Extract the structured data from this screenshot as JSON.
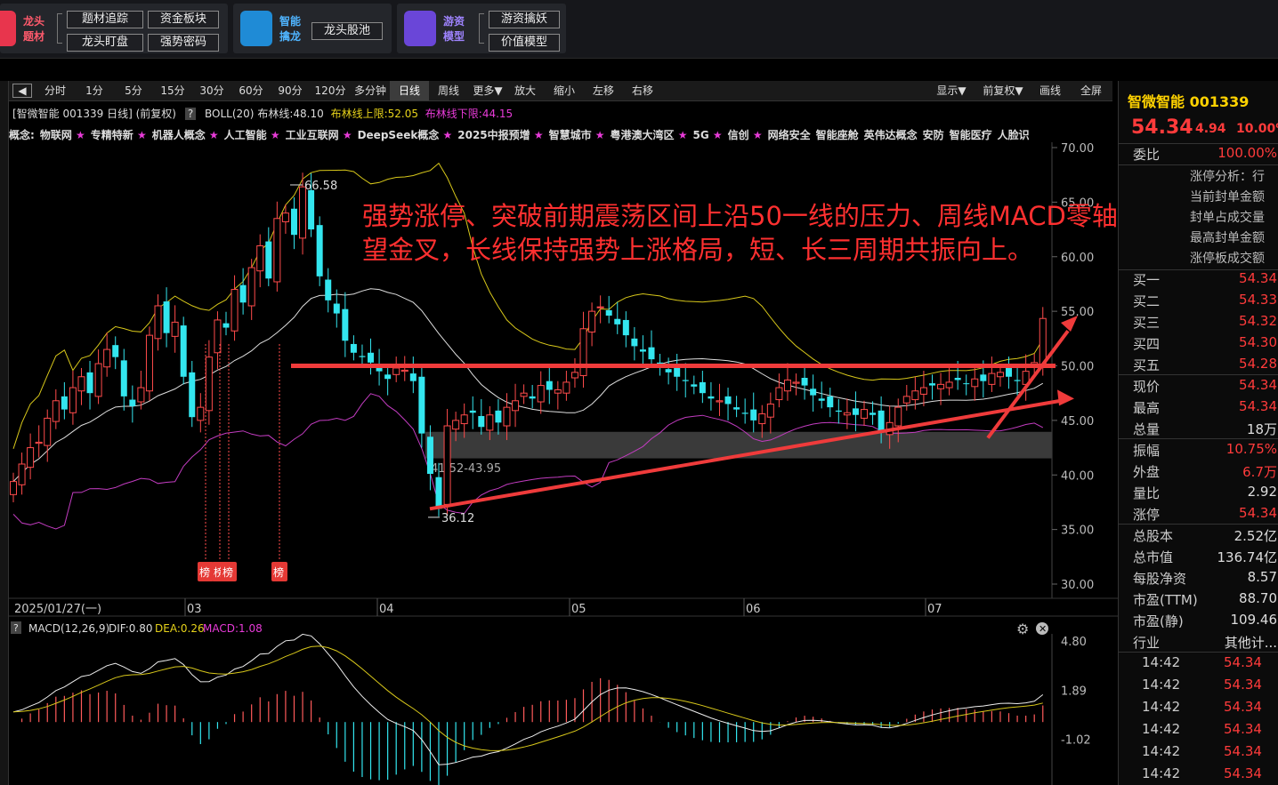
{
  "top_toolbar": {
    "group1": {
      "title": "龙头题材",
      "buttons": [
        "题材追踪",
        "资金板块",
        "龙头盯盘",
        "强势密码"
      ]
    },
    "group2": {
      "title": "智能擒龙",
      "buttons": [
        "龙头股池"
      ]
    },
    "group3": {
      "title": "游资模型",
      "buttons": [
        "游资擒妖",
        "价值模型"
      ]
    }
  },
  "chart_toolbar": {
    "periods": [
      "分时",
      "1分",
      "5分",
      "15分",
      "30分",
      "60分",
      "90分",
      "120分",
      "多分钟",
      "日线",
      "周线",
      "更多▼"
    ],
    "active_period": "日线",
    "tools": [
      "放大",
      "缩小",
      "左移",
      "右移"
    ],
    "right_tools": [
      "显示▼",
      "前复权▼",
      "画线",
      "全屏"
    ]
  },
  "info_line": {
    "stock": "[智微智能 001339 日线] (前复权)",
    "help": "?",
    "boll_label": "BOLL(20)",
    "mid": "布林线:48.10",
    "upper": "布林线上限:52.05",
    "lower": "布林线下限:44.15"
  },
  "concept_line": {
    "prefix": "概念:",
    "items": [
      {
        "name": "物联网",
        "star": true
      },
      {
        "name": "专精特新",
        "star": true
      },
      {
        "name": "机器人概念",
        "star": true
      },
      {
        "name": "人工智能",
        "star": true
      },
      {
        "name": "工业互联网",
        "star": true
      },
      {
        "name": "DeepSeek概念",
        "star": true
      },
      {
        "name": "2025中报预增",
        "star": true
      },
      {
        "name": "智慧城市",
        "star": true
      },
      {
        "name": "粤港澳大湾区",
        "star": true
      },
      {
        "name": "5G",
        "star": true
      },
      {
        "name": "信创",
        "star": true
      },
      {
        "name": "网络安全",
        "star": false
      },
      {
        "name": "智能座舱",
        "star": false
      },
      {
        "name": "英伟达概念",
        "star": false
      },
      {
        "name": "安防",
        "star": false
      },
      {
        "name": "智能医疗",
        "star": false
      },
      {
        "name": "人脸识",
        "star": false
      }
    ]
  },
  "annotation_text": "强势涨停、突破前期震荡区间上沿50一线的压力、周线MACD零轴上有望金叉，长线保持强势上涨格局，短、长三周期共振向上。",
  "chart_data": [
    {
      "type": "candlestick",
      "price_axis": [
        70.0,
        65.0,
        60.0,
        55.0,
        50.0,
        45.0,
        40.0,
        35.0,
        30.0
      ],
      "price_axis_labels": [
        "70.00",
        "65.00",
        "60.00",
        "55.00",
        "50.00",
        "45.00",
        "40.00",
        "35.00",
        "30.00"
      ],
      "x_axis_labels": [
        "2025/01/27(一)",
        "03",
        "04",
        "05",
        "06",
        "07"
      ],
      "high_marker": "66.58",
      "low_marker": "36.12",
      "zone_label": "41.52-43.95",
      "zone_range": [
        41.52,
        43.95
      ],
      "resistance_level": 50.0,
      "badges": [
        "榜",
        "榜",
        "榜",
        "榜"
      ],
      "close": [
        39.4,
        41.0,
        42.5,
        43.0,
        45.2,
        46.8,
        46.0,
        48.0,
        49.0,
        47.5,
        50.2,
        51.5,
        50.8,
        47.2,
        46.3,
        48.0,
        52.8,
        55.5,
        53.0,
        54.0,
        49.0,
        45.3,
        46.2,
        50.8,
        54.2,
        53.5,
        57.0,
        55.8,
        59.0,
        61.0,
        58.0,
        63.5,
        64.0,
        62.0,
        66.4,
        62.5,
        58.2,
        56.0,
        54.8,
        52.3,
        51.2,
        50.8,
        50.3,
        49.5,
        48.8,
        49.8,
        49.6,
        48.6,
        43.8,
        40.1,
        36.9,
        44.5,
        45.0,
        45.5,
        45.7,
        44.4,
        45.5,
        44.8,
        46.2,
        46.8,
        47.5,
        47.0,
        48.2,
        47.8,
        47.8,
        48.5,
        49.4,
        53.4,
        55.0,
        55.4,
        54.6,
        53.8,
        52.8,
        51.8,
        51.3,
        50.6,
        50.0,
        49.4,
        49.0,
        48.6,
        48.1,
        47.5,
        47.0,
        46.8,
        46.5,
        46.0,
        45.6,
        45.0,
        45.6,
        46.5,
        48.0,
        48.7,
        48.5,
        48.2,
        47.3,
        46.8,
        46.2,
        45.8,
        45.7,
        45.5,
        46.0,
        45.5,
        44.0,
        44.8,
        46.2,
        47.2,
        47.7,
        48.0,
        48.2,
        48.3,
        48.5,
        48.7,
        48.4,
        48.8,
        48.6,
        49.3,
        49.4,
        49.0,
        48.6,
        49.5,
        50.3,
        54.34
      ]
    },
    {
      "type": "bar",
      "title": "MACD(12,26,9)",
      "dif": "DIF:0.80",
      "dea": "DEA:0.26",
      "macd": "MACD:1.08",
      "axis_labels": [
        "4.80",
        "1.89",
        "-1.02"
      ],
      "axis_values": [
        4.8,
        1.89,
        -1.02
      ]
    }
  ],
  "right_panel": {
    "title": "智微智能 001339",
    "price": "54.34",
    "change": "4.94",
    "pct": "10.00%",
    "weibi_label": "委比",
    "weibi_val": "100.00%",
    "zt_rows": [
      "涨停分析：行",
      "当前封单金额",
      "封单占成交量",
      "最高封单金额",
      "涨停板成交额"
    ],
    "buy_rows": [
      {
        "label": "买一",
        "val": "54.34"
      },
      {
        "label": "买二",
        "val": "54.33"
      },
      {
        "label": "买三",
        "val": "54.32"
      },
      {
        "label": "买四",
        "val": "54.30"
      },
      {
        "label": "买五",
        "val": "54.28"
      }
    ],
    "quote_rows": [
      {
        "label": "现价",
        "val": "54.34",
        "cls": "red"
      },
      {
        "label": "最高",
        "val": "54.34",
        "cls": "red"
      },
      {
        "label": "总量",
        "val": "18万",
        "cls": "wht"
      }
    ],
    "stat_rows": [
      {
        "label": "振幅",
        "val": "10.75%",
        "cls": "red"
      },
      {
        "label": "外盘",
        "val": "6.7万",
        "cls": "red"
      },
      {
        "label": "量比",
        "val": "2.92",
        "cls": "wht"
      },
      {
        "label": "涨停",
        "val": "54.34",
        "cls": "red"
      }
    ],
    "fund_rows": [
      {
        "label": "总股本",
        "val": "2.52亿"
      },
      {
        "label": "总市值",
        "val": "136.74亿"
      },
      {
        "label": "每股净资",
        "val": "8.57"
      },
      {
        "label": "市盈(TTM)",
        "val": "88.70"
      },
      {
        "label": "市盈(静)",
        "val": "109.46"
      },
      {
        "label": "行业",
        "val": "其他计..."
      }
    ],
    "ticks": [
      {
        "time": "14:42",
        "price": "54.34"
      },
      {
        "time": "14:42",
        "price": "54.34"
      },
      {
        "time": "14:42",
        "price": "54.34"
      },
      {
        "time": "14:42",
        "price": "54.34"
      },
      {
        "time": "14:42",
        "price": "54.34"
      },
      {
        "time": "14:42",
        "price": "54.34"
      }
    ]
  }
}
